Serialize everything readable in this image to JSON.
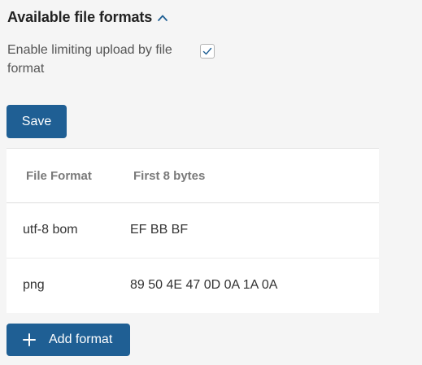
{
  "section": {
    "title": "Available file formats"
  },
  "option": {
    "label": "Enable limiting upload by file format",
    "checked": true
  },
  "save_button": {
    "label": "Save"
  },
  "table": {
    "headers": {
      "format": "File Format",
      "bytes": "First 8 bytes"
    },
    "rows": [
      {
        "format": "utf-8 bom",
        "bytes": "EF BB BF"
      },
      {
        "format": "png",
        "bytes": "89 50 4E 47 0D 0A 1A 0A"
      }
    ]
  },
  "add_button": {
    "label": "Add format",
    "icon": "plus-icon"
  },
  "colors": {
    "accent": "#1f5f94",
    "background": "#f5f5f5"
  }
}
